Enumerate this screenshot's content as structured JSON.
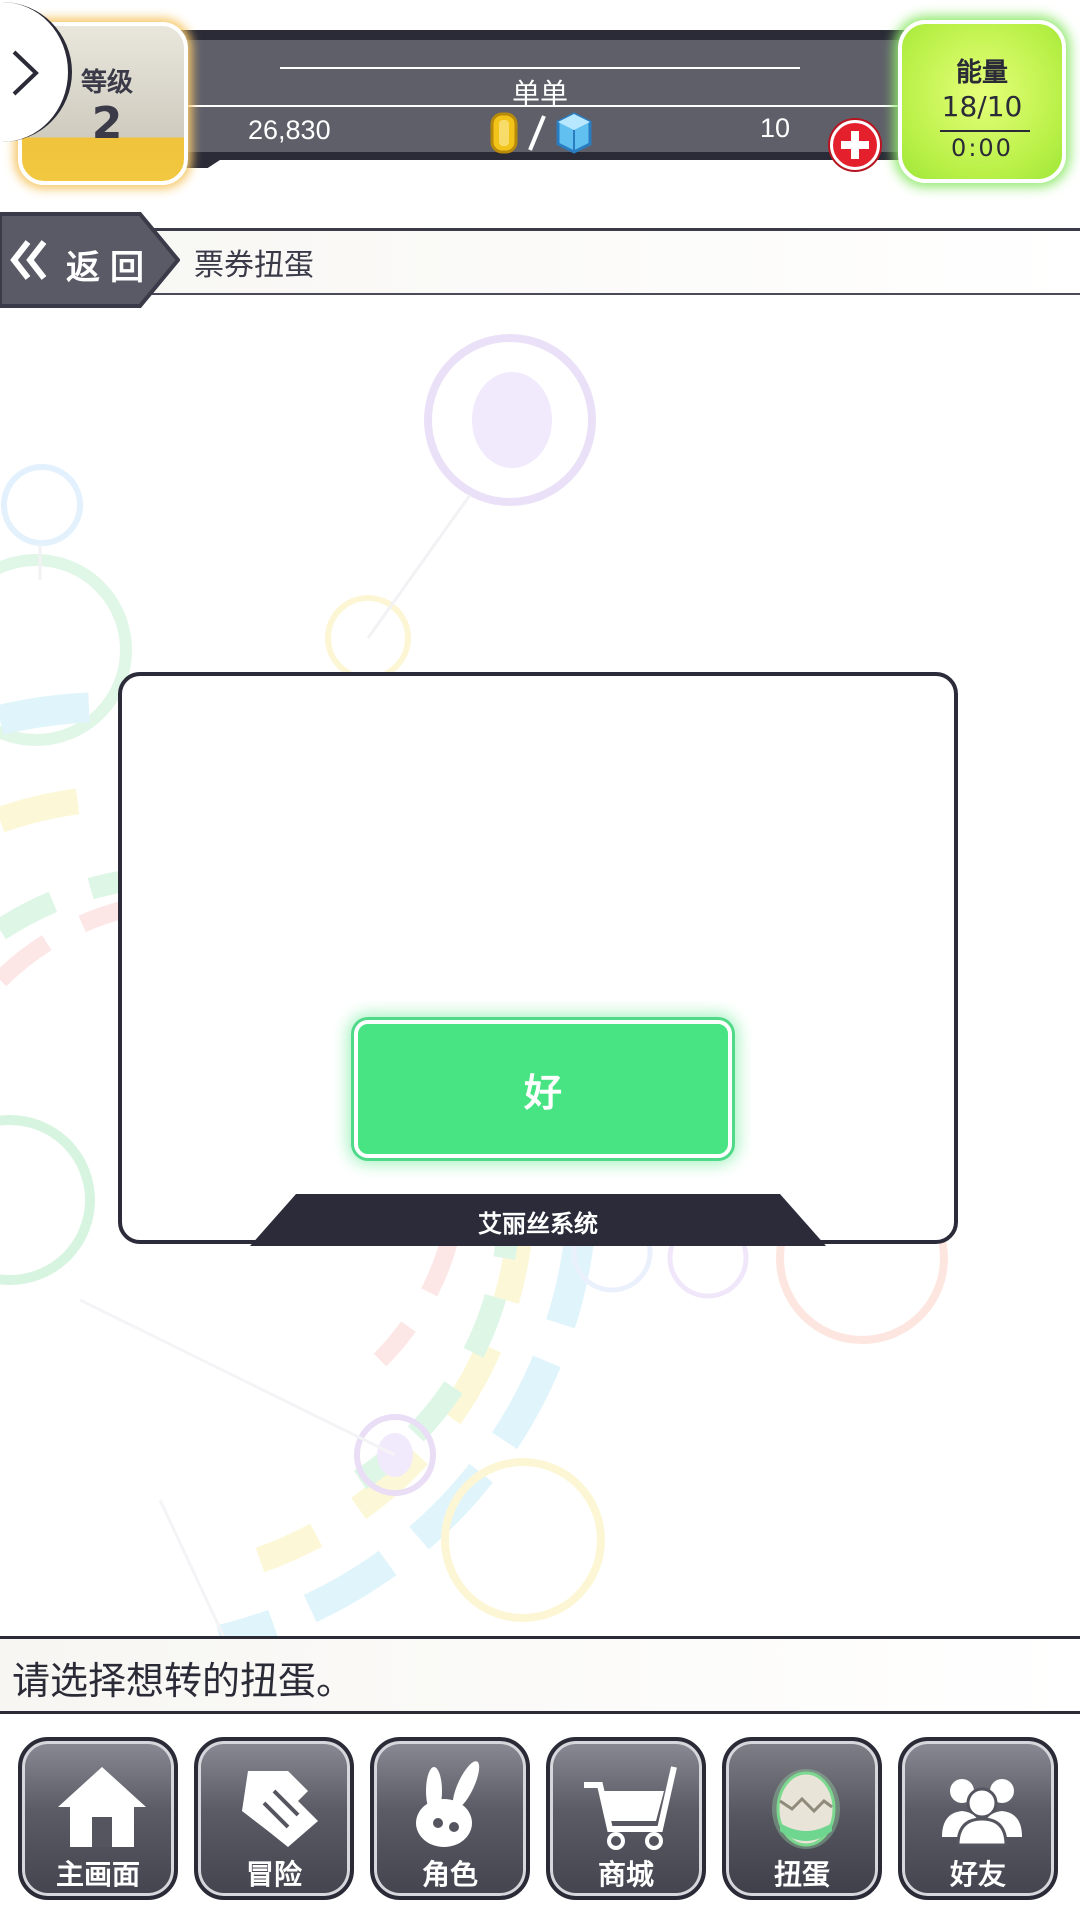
{
  "header": {
    "level_label": "等级",
    "level_value": "2",
    "player_name": "单单",
    "coins": "26,830",
    "gems": "10",
    "energy_label": "能量",
    "energy_value": "18/10",
    "energy_timer": "0:00"
  },
  "nav": {
    "back_label": "返回",
    "page_title": "票券扭蛋"
  },
  "dialog": {
    "ok_label": "好",
    "footer_label": "艾丽丝系统"
  },
  "message": "请选择想转的扭蛋。",
  "tabs": [
    {
      "label": "主画面",
      "icon": "home-icon"
    },
    {
      "label": "冒险",
      "icon": "handshake-icon"
    },
    {
      "label": "角色",
      "icon": "rabbit-icon"
    },
    {
      "label": "商城",
      "icon": "shopping-cart-icon"
    },
    {
      "label": "扭蛋",
      "icon": "egg-icon",
      "active": true
    },
    {
      "label": "好友",
      "icon": "friends-icon"
    }
  ],
  "colors": {
    "accent_green": "#48e382",
    "energy_yellow_green": "#b8f046",
    "level_gold": "#f2c842",
    "dark": "#2b2b38",
    "add_red": "#e3202c"
  }
}
